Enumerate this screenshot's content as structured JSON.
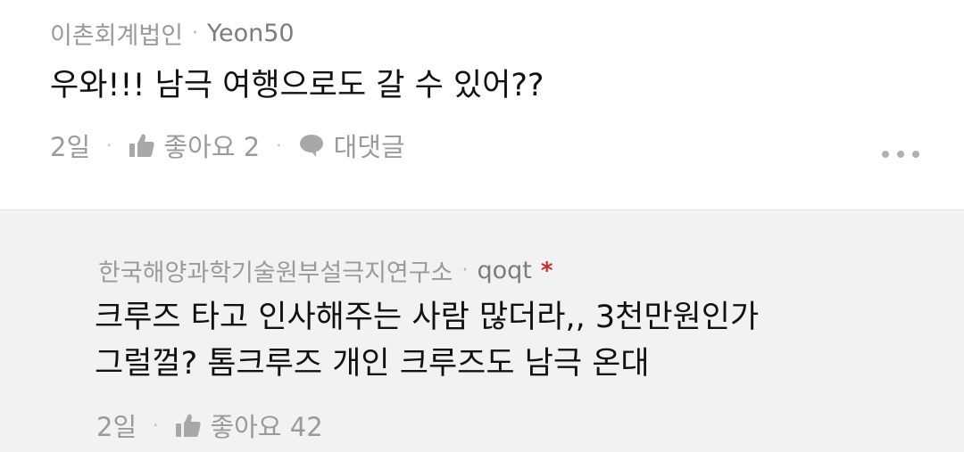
{
  "comments": [
    {
      "org": "이촌회계법인",
      "user": "Yeon50",
      "text": "우와!!! 남극 여행으로도 갈 수 있어??",
      "time": "2일",
      "like_label": "좋아요 2",
      "reply_label": "대댓글"
    }
  ],
  "reply": {
    "org": "한국해양과학기술원부설극지연구소",
    "user": "qoqt",
    "author_mark": "*",
    "text_line1": "크루즈 타고 인사해주는 사람 많더라,, 3천만원인가",
    "text_line2": "그럴껄? 톰크루즈 개인 크루즈도 남극 온대",
    "time": "2일",
    "like_label": "좋아요 42"
  },
  "separator": "·",
  "icons": {
    "like": "thumbs-up-icon",
    "reply": "speech-bubble-icon",
    "more": "more-options-icon"
  },
  "colors": {
    "author_mark": "#d0262d",
    "reply_background": "#f2f2f2",
    "muted_text": "#9a9a9a"
  }
}
